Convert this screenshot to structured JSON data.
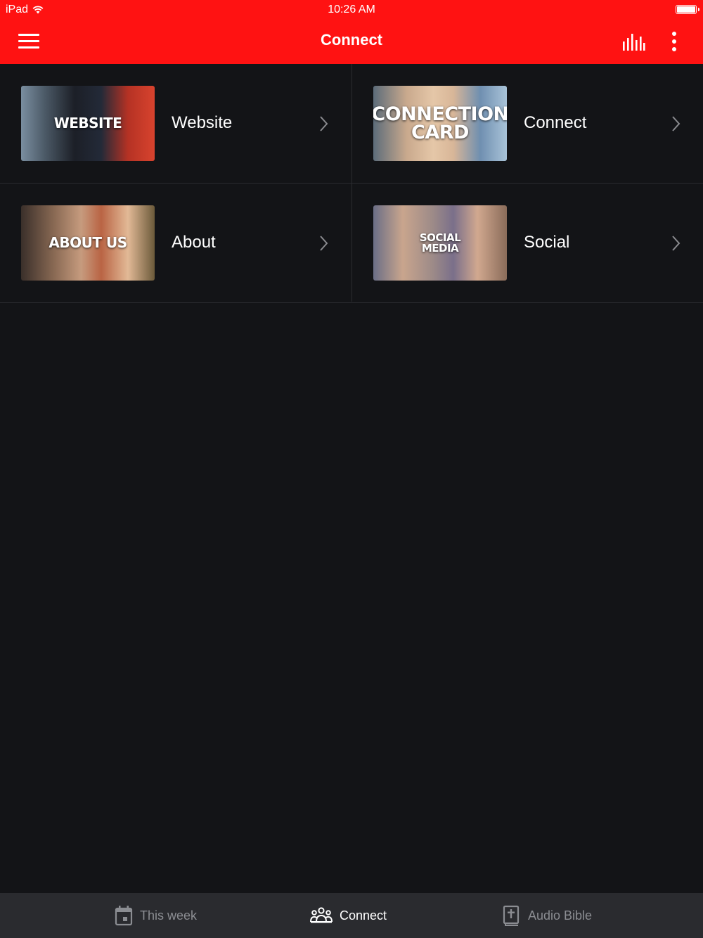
{
  "status_bar": {
    "carrier": "iPad",
    "time": "10:26 AM"
  },
  "header": {
    "title": "Connect"
  },
  "items": [
    {
      "label": "Website",
      "thumb_text": "WEBSITE"
    },
    {
      "label": "Connect",
      "thumb_text": "CONNECTION\nCARD"
    },
    {
      "label": "About",
      "thumb_text": "ABOUT US"
    },
    {
      "label": "Social",
      "thumb_text": "SOCIAL\nMEDIA"
    }
  ],
  "tabs": [
    {
      "label": "This week",
      "icon": "calendar-icon",
      "active": false
    },
    {
      "label": "Connect",
      "icon": "people-icon",
      "active": true
    },
    {
      "label": "Audio Bible",
      "icon": "bible-icon",
      "active": false
    }
  ],
  "colors": {
    "accent": "#ff1212",
    "background": "#131417",
    "tabbar": "#2a2b2f"
  }
}
